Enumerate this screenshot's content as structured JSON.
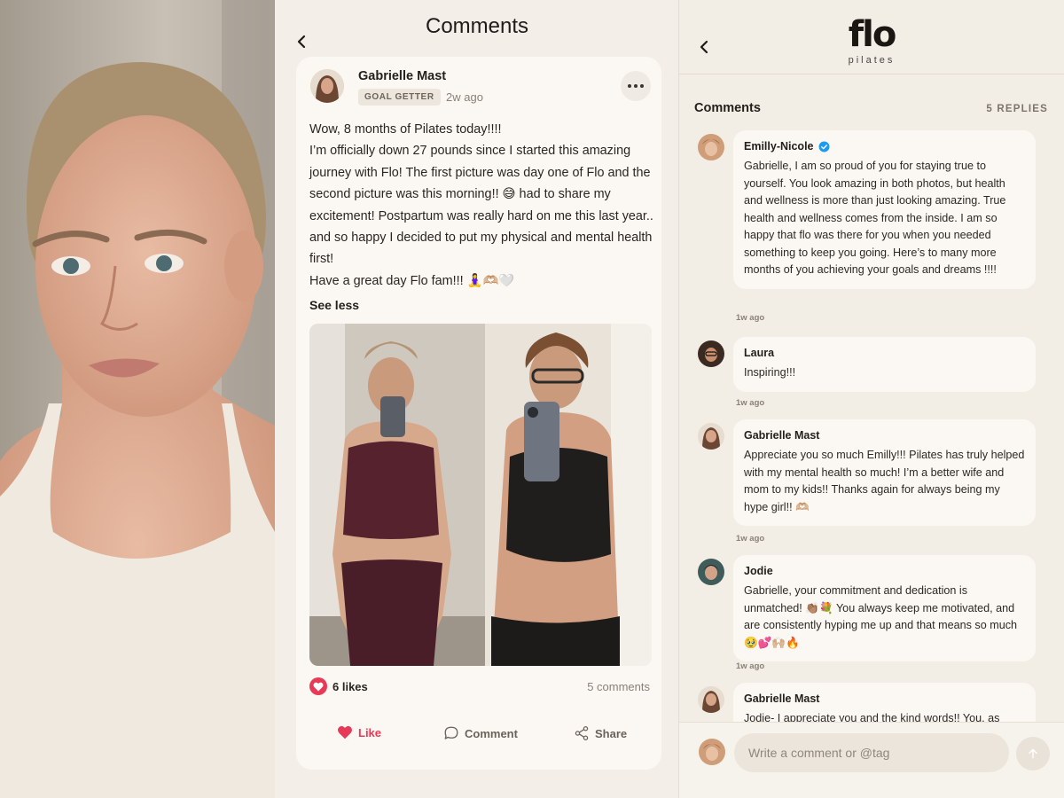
{
  "post_screen": {
    "title": "Comments",
    "author": {
      "name": "Gabrielle Mast",
      "badge": "GOAL GETTER",
      "time": "2w ago"
    },
    "body": [
      "Wow, 8 months of Pilates today!!!!",
      "I’m officially down 27 pounds since I started this amazing journey with Flo! The first picture was day one of Flo and the second picture was this morning!! 😅 had to share my excitement!  Postpartum was really hard on me this last year.. and so happy I decided to put my physical and mental health first!",
      "Have a great day Flo fam!!! 🧘‍♀️🫶🏼🤍"
    ],
    "see_less": "See less",
    "likes": "6 likes",
    "comments_count": "5 comments",
    "actions": {
      "like": "Like",
      "comment": "Comment",
      "share": "Share"
    },
    "colors": {
      "like": "#e63a56",
      "card": "#fbf8f4"
    }
  },
  "comments_screen": {
    "brand": {
      "logo": "flo",
      "sub": "pilates"
    },
    "section_title": "Comments",
    "replies_count": "5 REPLIES",
    "comments": [
      {
        "name": "Emilly-Nicole",
        "verified": true,
        "text": "Gabrielle, I am so proud of you for staying true to yourself. You look amazing in both photos, but health and wellness is more than just looking amazing. True health and wellness comes from the inside. I am so happy that flo was there for you when you needed something to keep you going. Here’s to many more months of you achieving your goals and dreams !!!!",
        "time": "1w ago"
      },
      {
        "name": "Laura",
        "text": "Inspiring!!!",
        "time": "1w ago"
      },
      {
        "name": "Gabrielle Mast",
        "text": "Appreciate you so much Emilly!!! Pilates has truly helped with my mental health so much! I’m a better wife and mom to my kids!! Thanks again for always being my hype girl!! 🫶🏼",
        "time": "1w ago"
      },
      {
        "name": "Jodie",
        "text": "Gabrielle, your commitment and dedication is unmatched! 👏🏽💐 You always keep me motivated, and are consistently hyping me up and that means so much 🥹💕🙌🏼🔥",
        "time": "1w ago"
      },
      {
        "name": "Gabrielle Mast",
        "text": "Jodie- I appreciate you and the kind words!! You, as",
        "time": ""
      }
    ],
    "input_placeholder": "Write a comment or @tag",
    "icons": [
      "back-arrow-icon",
      "verified-check-icon",
      "send-arrow-icon",
      "heart-icon",
      "comment-bubble-icon",
      "share-icon"
    ]
  }
}
